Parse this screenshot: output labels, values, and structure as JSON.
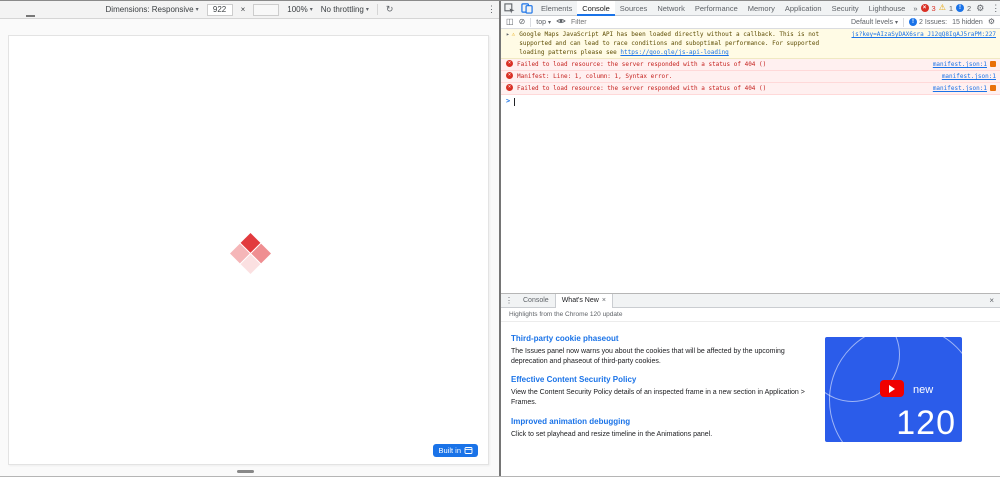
{
  "colors": {
    "accent": "#1a73e8",
    "error": "#d93025",
    "error_bg": "#fff0f0",
    "warning": "#e8a400",
    "warning_bg": "#fffbe5",
    "badge_blue": "#1a73e8",
    "whatsnew_blue": "#2b5cea",
    "play_red": "#f00000",
    "diamond_reds": [
      "#e23b3e",
      "#ef8e91",
      "#f5b6b8",
      "#fbe0e1"
    ]
  },
  "icons": {
    "kebab": "⋮",
    "gear": "⚙",
    "clear": "⊘",
    "sidebar_toggle": "◫",
    "dropdown": "▾",
    "overflow": "»",
    "warning": "⚠",
    "expander": "▸",
    "close": "×",
    "rotate": "↻",
    "exclaim": "!"
  },
  "emulator": {
    "toolbar": {
      "dimensions_label": "Dimensions: Responsive",
      "width": "922",
      "multiply": "×",
      "zoom": "100%",
      "throttling": "No throttling"
    },
    "badge": "Built in"
  },
  "devtools": {
    "tabs": [
      "Elements",
      "Console",
      "Sources",
      "Network",
      "Performance",
      "Memory",
      "Application",
      "Security",
      "Lighthouse"
    ],
    "selected_tab": "Console",
    "error_count": "3",
    "warning_count": "1",
    "issue_count": "2"
  },
  "console": {
    "context": "top",
    "filter_placeholder": "Filter",
    "levels_label": "Default levels",
    "issues_label": "2 Issues:",
    "hidden_label": "15 hidden",
    "prompt": ">",
    "messages": [
      {
        "kind": "warning",
        "text": "Google Maps JavaScript API has been loaded directly without a callback. This is not supported and can lead to race conditions and suboptimal performance. For supported loading patterns please see ",
        "link": "https://goo.gle/js-api-loading",
        "source": "js?key=AIzaSyDAX6sra_J12qQ8IgAJ5raPM:227"
      },
      {
        "kind": "error",
        "text": "Failed to load resource: the server responded with a status of 404 ()",
        "source": "manifest.json:1"
      },
      {
        "kind": "error",
        "text": "Manifest: Line: 1, column: 1, Syntax error.",
        "source": "manifest.json:1"
      },
      {
        "kind": "error",
        "text": "Failed to load resource: the server responded with a status of 404 ()",
        "source": "manifest.json:1"
      }
    ]
  },
  "drawer": {
    "tabs": [
      "Console",
      "What's New"
    ],
    "selected_tab": "What's New",
    "header": "Highlights from the Chrome 120 update",
    "sections": [
      {
        "title": "Third-party cookie phaseout",
        "body": "The Issues panel now warns you about the cookies that will be affected by the upcoming deprecation and phaseout of third-party cookies."
      },
      {
        "title": "Effective Content Security Policy",
        "body": "View the Content Security Policy details of an inspected frame in a new section in Application > Frames."
      },
      {
        "title": "Improved animation debugging",
        "body": "Click to set playhead and resize timeline in the Animations panel."
      }
    ],
    "image": {
      "word": "new",
      "version": "120"
    }
  }
}
